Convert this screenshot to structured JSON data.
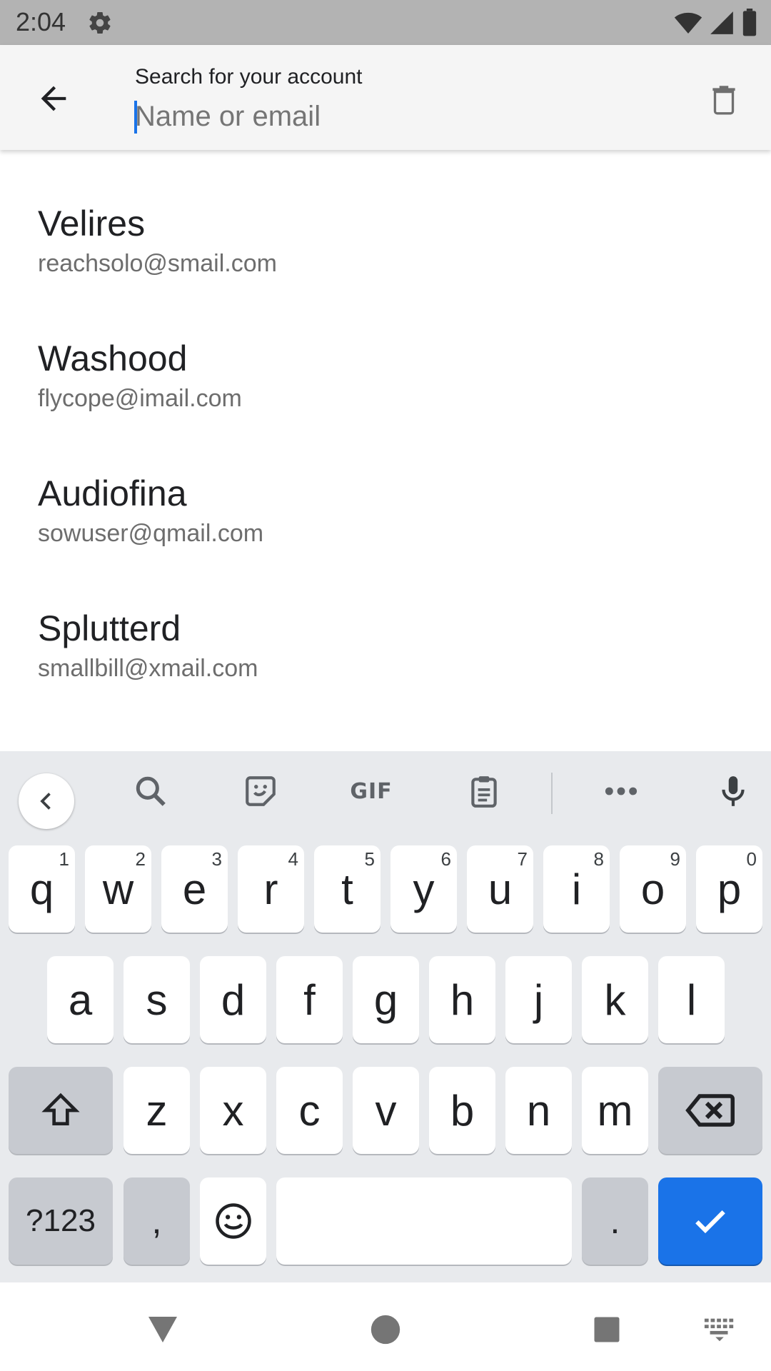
{
  "status_bar": {
    "time": "2:04",
    "icons": [
      "settings-icon",
      "wifi-icon",
      "signal-icon",
      "battery-icon"
    ]
  },
  "header": {
    "back_icon": "arrow-back-icon",
    "search_label": "Search for your account",
    "search_placeholder": "Name or email",
    "search_value": "",
    "clear_icon": "trash-icon"
  },
  "accounts": [
    {
      "name": "Velires",
      "email": "reachsolo@smail.com"
    },
    {
      "name": "Washood",
      "email": "flycope@imail.com"
    },
    {
      "name": "Audiofina",
      "email": "sowuser@qmail.com"
    },
    {
      "name": "Splutterd",
      "email": "smallbill@xmail.com"
    }
  ],
  "keyboard": {
    "toolbar": [
      "collapse-icon",
      "search-icon",
      "sticker-icon",
      "GIF",
      "clipboard-icon",
      "more-icon",
      "mic-icon"
    ],
    "gif_label": "GIF",
    "row1": [
      {
        "key": "q",
        "hint": "1"
      },
      {
        "key": "w",
        "hint": "2"
      },
      {
        "key": "e",
        "hint": "3"
      },
      {
        "key": "r",
        "hint": "4"
      },
      {
        "key": "t",
        "hint": "5"
      },
      {
        "key": "y",
        "hint": "6"
      },
      {
        "key": "u",
        "hint": "7"
      },
      {
        "key": "i",
        "hint": "8"
      },
      {
        "key": "o",
        "hint": "9"
      },
      {
        "key": "p",
        "hint": "0"
      }
    ],
    "row2": [
      "a",
      "s",
      "d",
      "f",
      "g",
      "h",
      "j",
      "k",
      "l"
    ],
    "row3": [
      "z",
      "x",
      "c",
      "v",
      "b",
      "n",
      "m"
    ],
    "symbols_label": "?123",
    "comma": ",",
    "period": ".",
    "accent_color": "#1a73e8"
  },
  "nav_bar": {
    "icons": [
      "back-triangle-icon",
      "home-circle-icon",
      "recents-square-icon",
      "keyboard-switch-icon"
    ]
  }
}
